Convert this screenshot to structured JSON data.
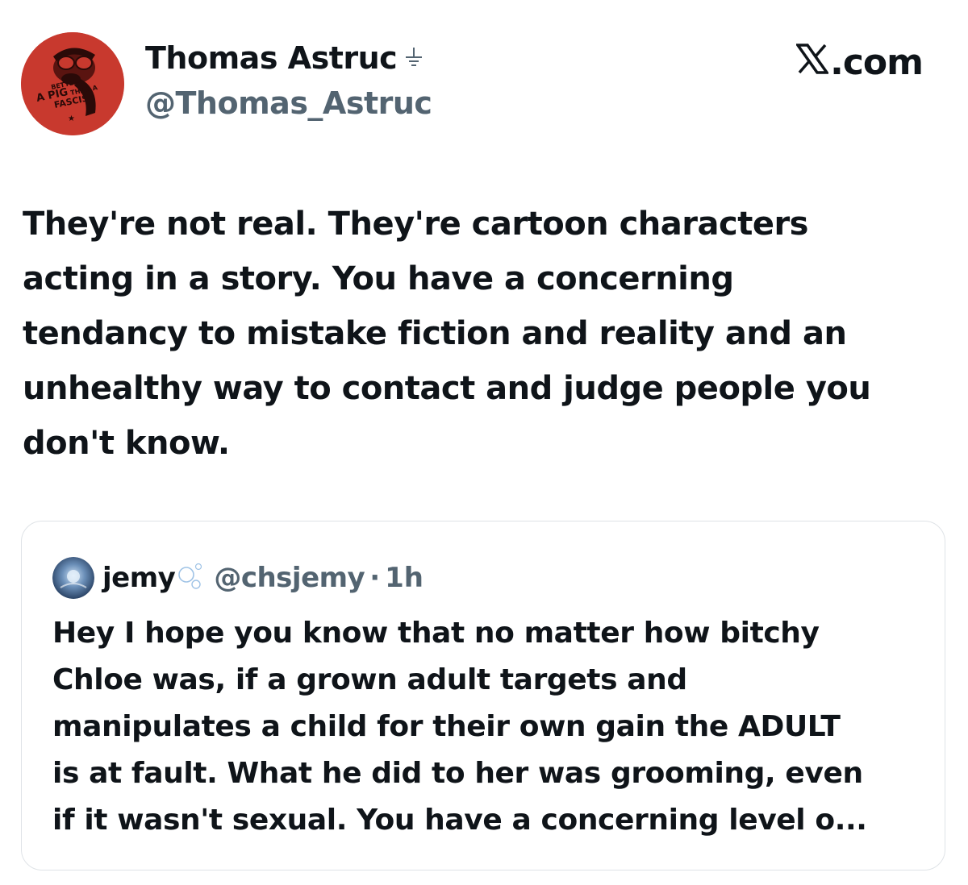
{
  "author": {
    "display_name": "Thomas Astruc",
    "handle": "@Thomas_Astruc",
    "avatar_text": [
      "BETTER",
      "A PIG",
      "THAN A",
      "FASCIST"
    ],
    "avatar_color": "#c8392e"
  },
  "site": {
    "label": ".com"
  },
  "tweet": {
    "lines": [
      "They're not real. They're  cartoon characters",
      "acting in a story. You have a concerning",
      "tendancy to mistake fiction and reality and an",
      "unhealthy way to contact and judge people you",
      "don't know."
    ]
  },
  "quote": {
    "name": "jemy",
    "handle": "@chsjemy",
    "dot": "·",
    "time": "1h",
    "lines": [
      "Hey I hope you know that no matter how bitchy",
      "Chloe was, if a grown adult targets and",
      "manipulates a child for their own gain the ADULT",
      "is at fault. What he did to her was grooming, even",
      "if it wasn't sexual. You have a concerning level o..."
    ]
  },
  "colors": {
    "text": "#0f1419",
    "secondary": "#536471",
    "border": "#dfe3e7"
  }
}
